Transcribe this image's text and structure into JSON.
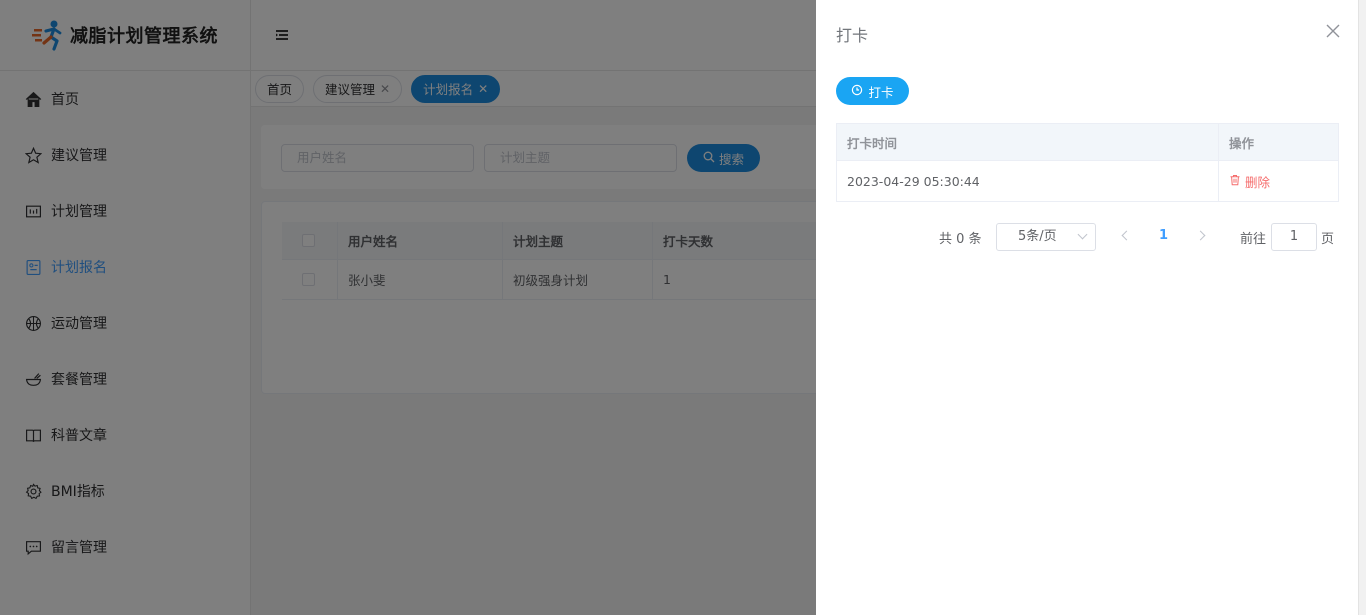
{
  "app": {
    "title": "减脂计划管理系统"
  },
  "sidebar": {
    "items": [
      {
        "label": "首页",
        "icon": "home-icon"
      },
      {
        "label": "建议管理",
        "icon": "star-icon"
      },
      {
        "label": "计划管理",
        "icon": "plan-icon"
      },
      {
        "label": "计划报名",
        "icon": "enroll-icon"
      },
      {
        "label": "运动管理",
        "icon": "basketball-icon"
      },
      {
        "label": "套餐管理",
        "icon": "bowl-icon"
      },
      {
        "label": "科普文章",
        "icon": "book-icon"
      },
      {
        "label": "BMI指标",
        "icon": "gear-icon"
      },
      {
        "label": "留言管理",
        "icon": "message-icon"
      }
    ],
    "active_index": 3
  },
  "tabs": [
    {
      "label": "首页"
    },
    {
      "label": "建议管理"
    },
    {
      "label": "计划报名"
    }
  ],
  "search": {
    "user_placeholder": "用户姓名",
    "plan_placeholder": "计划主题",
    "button_label": "搜索"
  },
  "table": {
    "columns": [
      "用户姓名",
      "计划主题",
      "打卡天数"
    ],
    "rows": [
      {
        "user": "张小斐",
        "plan": "初级强身计划",
        "days": "1"
      }
    ]
  },
  "drawer": {
    "title": "打卡",
    "punch_button": "打卡",
    "columns": [
      "打卡时间",
      "操作"
    ],
    "rows": [
      {
        "time": "2023-04-29 05:30:44",
        "action": "删除"
      }
    ]
  },
  "pagination": {
    "total_text": "共 0 条",
    "page_size": "5条/页",
    "current_page": "1",
    "goto_label": "前往",
    "goto_value": "1",
    "page_suffix": "页"
  },
  "colors": {
    "accent": "#1d8de0",
    "primary_button": "#1aa5f3",
    "danger": "#f56c6c"
  }
}
